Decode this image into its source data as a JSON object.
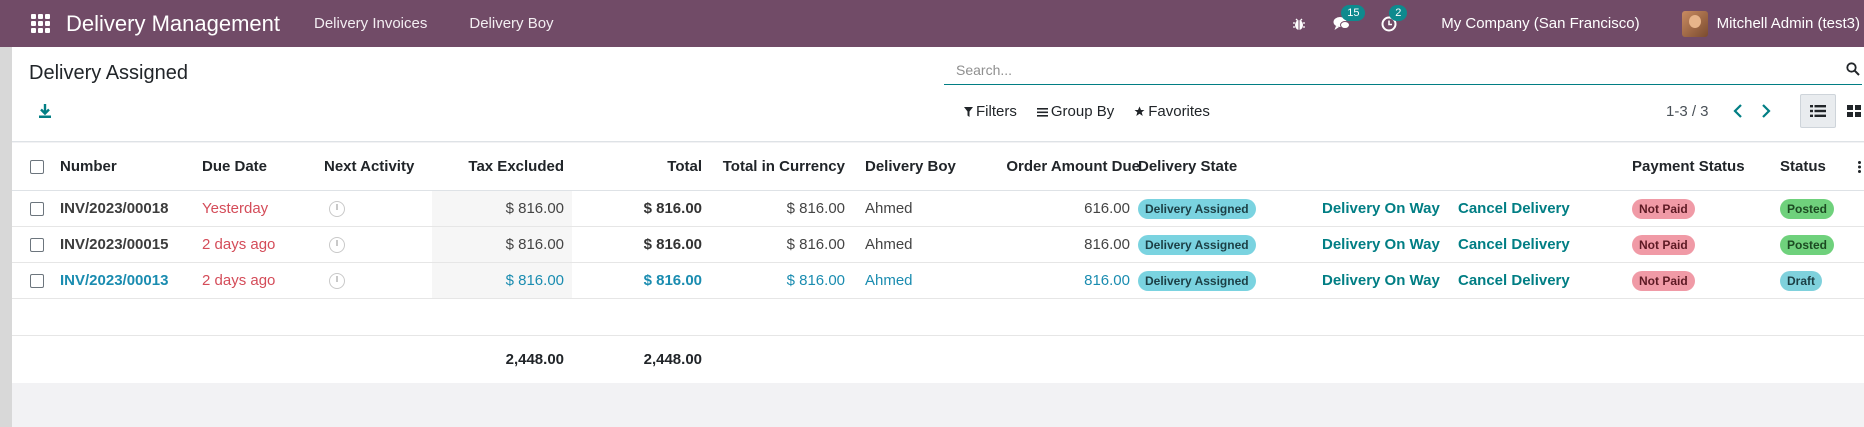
{
  "navbar": {
    "brand": "Delivery Management",
    "menu": [
      "Delivery Invoices",
      "Delivery Boy"
    ],
    "messages_count": "15",
    "activities_count": "2",
    "company": "My Company (San Francisco)",
    "user": "Mitchell Admin (test3)"
  },
  "control_panel": {
    "title": "Delivery Assigned",
    "search_placeholder": "Search...",
    "filters_label": "Filters",
    "group_by_label": "Group By",
    "favorites_label": "Favorites",
    "pager": "1-3 / 3"
  },
  "table": {
    "columns": {
      "number": "Number",
      "due_date": "Due Date",
      "next_activity": "Next Activity",
      "tax_excluded": "Tax Excluded",
      "total": "Total",
      "total_currency": "Total in Currency",
      "delivery_boy": "Delivery Boy",
      "order_amount_due": "Order Amount Due",
      "delivery_state": "Delivery State",
      "payment_status": "Payment Status",
      "status": "Status"
    },
    "rows": [
      {
        "number": "INV/2023/00018",
        "due_date": "Yesterday",
        "tax_excluded": "$ 816.00",
        "total": "$ 816.00",
        "total_currency": "$ 816.00",
        "delivery_boy": "Ahmed",
        "order_amount_due": "616.00",
        "delivery_state": "Delivery Assigned",
        "action_on_way": "Delivery On Way",
        "action_cancel": "Cancel Delivery",
        "payment_status": "Not Paid",
        "status": "Posted"
      },
      {
        "number": "INV/2023/00015",
        "due_date": "2 days ago",
        "tax_excluded": "$ 816.00",
        "total": "$ 816.00",
        "total_currency": "$ 816.00",
        "delivery_boy": "Ahmed",
        "order_amount_due": "816.00",
        "delivery_state": "Delivery Assigned",
        "action_on_way": "Delivery On Way",
        "action_cancel": "Cancel Delivery",
        "payment_status": "Not Paid",
        "status": "Posted"
      },
      {
        "number": "INV/2023/00013",
        "due_date": "2 days ago",
        "tax_excluded": "$ 816.00",
        "total": "$ 816.00",
        "total_currency": "$ 816.00",
        "delivery_boy": "Ahmed",
        "order_amount_due": "816.00",
        "delivery_state": "Delivery Assigned",
        "action_on_way": "Delivery On Way",
        "action_cancel": "Cancel Delivery",
        "payment_status": "Not Paid",
        "status": "Draft"
      }
    ],
    "totals": {
      "tax_excluded": "2,448.00",
      "total": "2,448.00"
    }
  },
  "colors": {
    "navbar": "#714b67",
    "accent": "#017e84",
    "overdue": "#d44c59"
  }
}
